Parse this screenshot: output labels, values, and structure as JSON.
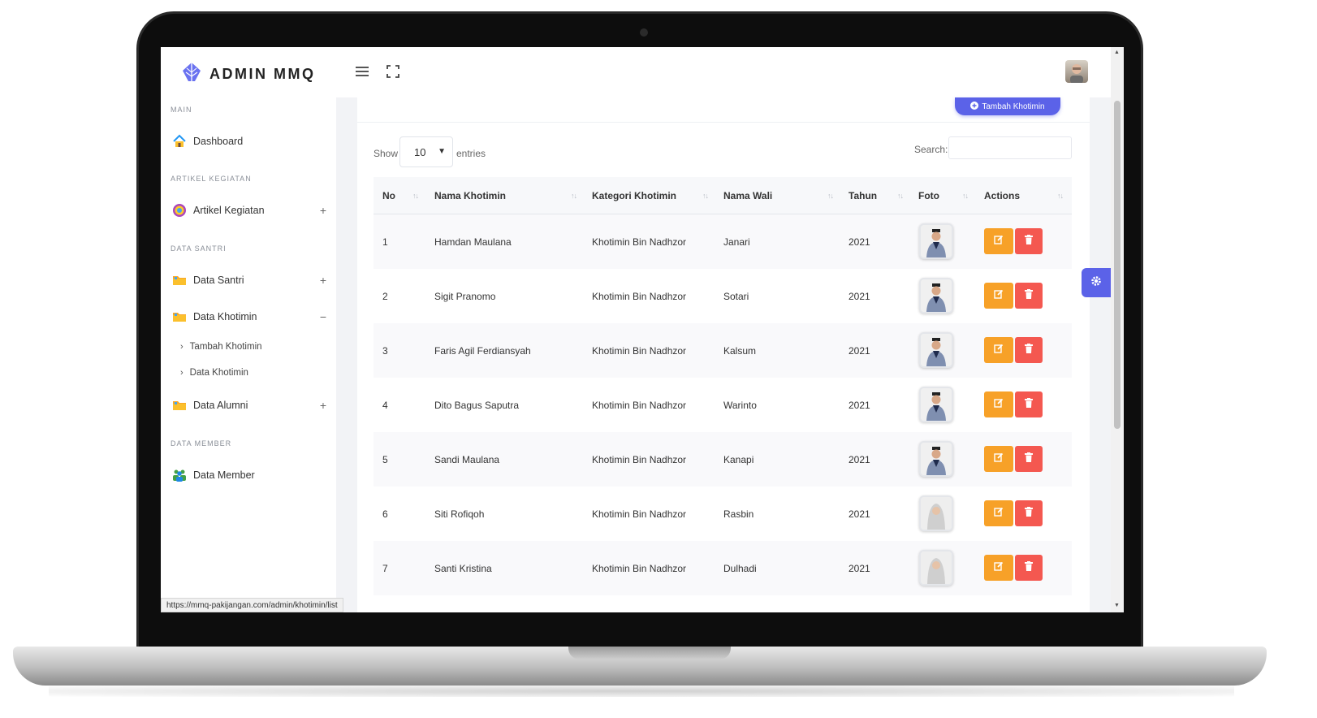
{
  "brand": {
    "name": "ADMIN MMQ"
  },
  "sidebar": {
    "sections": [
      {
        "title": "MAIN"
      },
      {
        "title": "ARTIKEL KEGIATAN"
      },
      {
        "title": "DATA SANTRI"
      },
      {
        "title": "DATA MEMBER"
      }
    ],
    "items": [
      {
        "label": "Dashboard",
        "icon": "home-icon"
      },
      {
        "label": "Artikel Kegiatan",
        "icon": "palette-icon",
        "toggle": "+"
      },
      {
        "label": "Data Santri",
        "icon": "folder-icon",
        "toggle": "+"
      },
      {
        "label": "Data Khotimin",
        "icon": "folder-icon",
        "toggle": "−"
      },
      {
        "label": "Data Alumni",
        "icon": "folder-icon",
        "toggle": "+"
      },
      {
        "label": "Data Member",
        "icon": "users-icon"
      }
    ],
    "subitems": [
      {
        "label": "Tambah Khotimin"
      },
      {
        "label": "Data Khotimin"
      }
    ]
  },
  "card": {
    "add_button_label": "Tambah Khotimin",
    "show_label": "Show",
    "page_length": "10",
    "entries_label": "entries",
    "search_label": "Search:"
  },
  "table": {
    "columns": [
      "No",
      "Nama Khotimin",
      "Kategori Khotimin",
      "Nama Wali",
      "Tahun",
      "Foto",
      "Actions"
    ],
    "rows": [
      {
        "no": "1",
        "nama": "Hamdan Maulana",
        "kategori": "Khotimin Bin Nadhzor",
        "wali": "Janari",
        "tahun": "2021"
      },
      {
        "no": "2",
        "nama": "Sigit Pranomo",
        "kategori": "Khotimin Bin Nadhzor",
        "wali": "Sotari",
        "tahun": "2021"
      },
      {
        "no": "3",
        "nama": "Faris Agil Ferdiansyah",
        "kategori": "Khotimin Bin Nadhzor",
        "wali": "Kalsum",
        "tahun": "2021"
      },
      {
        "no": "4",
        "nama": "Dito Bagus Saputra",
        "kategori": "Khotimin Bin Nadhzor",
        "wali": "Warinto",
        "tahun": "2021"
      },
      {
        "no": "5",
        "nama": "Sandi Maulana",
        "kategori": "Khotimin Bin Nadhzor",
        "wali": "Kanapi",
        "tahun": "2021"
      },
      {
        "no": "6",
        "nama": "Siti Rofiqoh",
        "kategori": "Khotimin Bin Nadhzor",
        "wali": "Rasbin",
        "tahun": "2021"
      },
      {
        "no": "7",
        "nama": "Santi Kristina",
        "kategori": "Khotimin Bin Nadhzor",
        "wali": "Dulhadi",
        "tahun": "2021"
      }
    ]
  },
  "status_bar": {
    "url": "https://mmq-pakijangan.com/admin/khotimin/list"
  },
  "colors": {
    "accent": "#5b62e8",
    "edit": "#f7a128",
    "delete": "#f45850"
  }
}
